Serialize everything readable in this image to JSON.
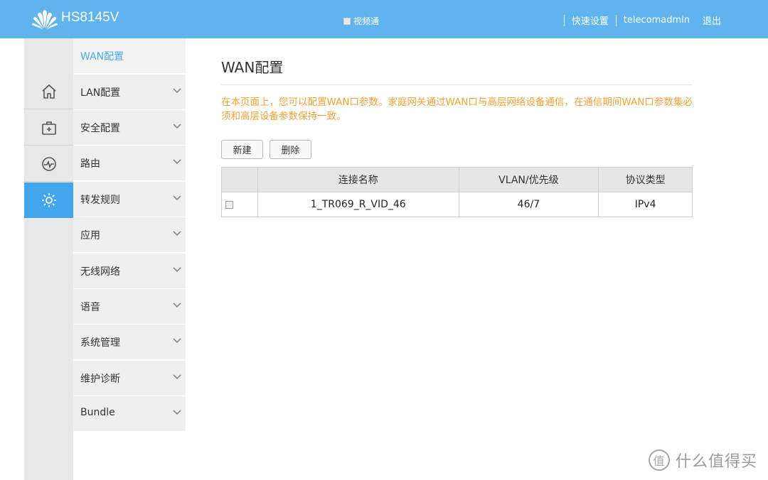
{
  "header": {
    "model": "HS8145V",
    "video_toggle_label": "视频通",
    "quick_setup": "快速设置",
    "user": "telecomadmin",
    "logout": "退出",
    "bg_color": "#5fb4ee"
  },
  "rail": {
    "items": [
      {
        "icon": "home-icon"
      },
      {
        "icon": "medical-kit-icon"
      },
      {
        "icon": "pulse-icon"
      },
      {
        "icon": "gear-icon",
        "active": true
      }
    ],
    "active_color": "#42a6ee"
  },
  "submenu": {
    "items": [
      {
        "label": "WAN配置",
        "active": true
      },
      {
        "label": "LAN配置"
      },
      {
        "label": "安全配置"
      },
      {
        "label": "路由"
      },
      {
        "label": "转发规则"
      },
      {
        "label": "应用"
      },
      {
        "label": "无线网络"
      },
      {
        "label": "语音"
      },
      {
        "label": "系统管理"
      },
      {
        "label": "维护诊断"
      },
      {
        "label": "Bundle"
      }
    ]
  },
  "main": {
    "title": "WAN配置",
    "description": "在本页面上，您可以配置WAN口参数。家庭网关通过WAN口与高层网络设备通信，在通信期间WAN口参数集必须和高层设备参数保持一致。",
    "new_button": "新建",
    "delete_button": "删除",
    "table": {
      "headers": [
        "",
        "连接名称",
        "VLAN/优先级",
        "协议类型"
      ],
      "rows": [
        {
          "name": "1_TR069_R_VID_46",
          "vlan": "46/7",
          "protocol": "IPv4"
        }
      ]
    },
    "desc_color": "#f2a23a"
  },
  "watermark": {
    "symbol": "值",
    "text": "什么值得买"
  }
}
